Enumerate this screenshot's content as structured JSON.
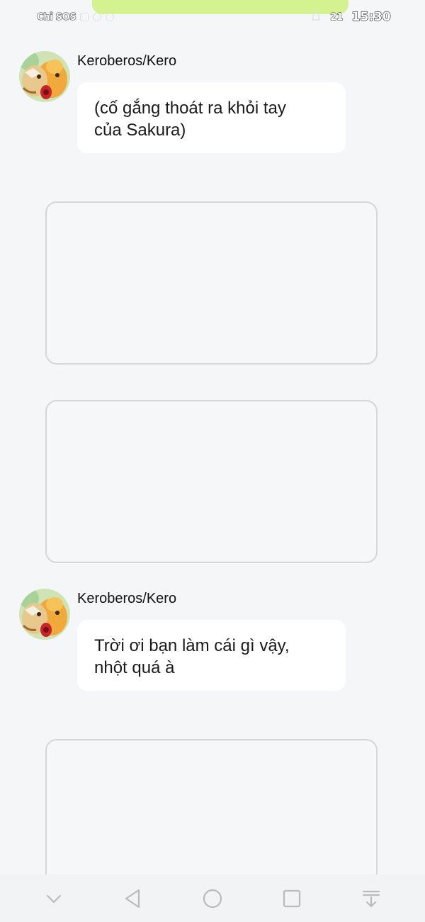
{
  "status_bar": {
    "carrier": "Chỉ SOS",
    "notification_count": "21",
    "time": "15:30"
  },
  "messages": [
    {
      "sender": "Keroberos/Kero",
      "avatar_icon": "kero-avatar",
      "text_line1": "(cố gắng thoát ra khỏi tay",
      "text_line2": "của Sakura)"
    },
    {
      "sender": "Keroberos/Kero",
      "avatar_icon": "kero-avatar",
      "text_line1": "Trời ơi bạn làm cái gì vậy,",
      "text_line2": "nhột quá à"
    }
  ],
  "navigation": {
    "buttons": [
      "chevron-down-icon",
      "back-icon",
      "home-icon",
      "recents-icon",
      "dock-down-icon"
    ]
  },
  "colors": {
    "background": "#f5f6f8",
    "bubble": "#ffffff",
    "card_border": "#d6d6d8",
    "banner": "#d4f28f"
  }
}
